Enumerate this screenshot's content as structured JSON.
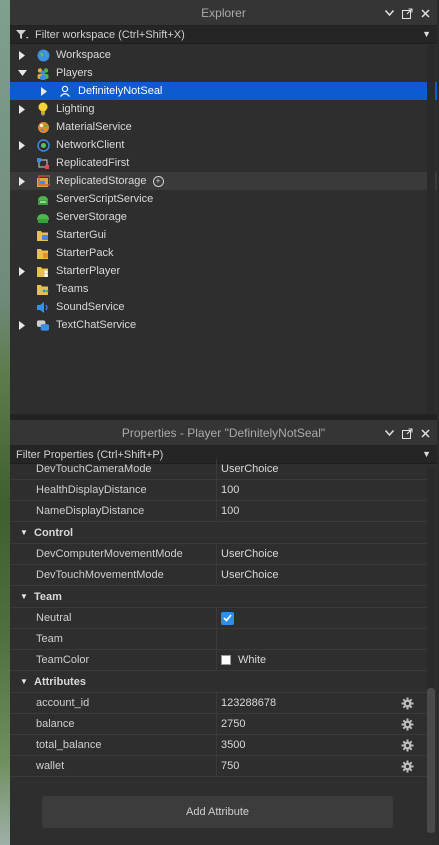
{
  "explorer": {
    "title": "Explorer",
    "filter_placeholder": "Filter workspace (Ctrl+Shift+X)",
    "items": [
      {
        "label": "Workspace",
        "icon": "globe-icon",
        "arrow": "right"
      },
      {
        "label": "Players",
        "icon": "players-icon",
        "arrow": "down"
      },
      {
        "label": "DefinitelyNotSeal",
        "icon": "player-icon",
        "arrow": "right",
        "selected": true
      },
      {
        "label": "Lighting",
        "icon": "lightbulb-icon",
        "arrow": "right"
      },
      {
        "label": "MaterialService",
        "icon": "material-service-icon",
        "arrow": ""
      },
      {
        "label": "NetworkClient",
        "icon": "network-icon",
        "arrow": "right"
      },
      {
        "label": "ReplicatedFirst",
        "icon": "replicated-first-icon",
        "arrow": ""
      },
      {
        "label": "ReplicatedStorage",
        "icon": "replicated-storage-icon",
        "arrow": "right",
        "hover": true
      },
      {
        "label": "ServerScriptService",
        "icon": "server-script-service-icon",
        "arrow": ""
      },
      {
        "label": "ServerStorage",
        "icon": "server-storage-icon",
        "arrow": ""
      },
      {
        "label": "StarterGui",
        "icon": "starter-gui-icon",
        "arrow": ""
      },
      {
        "label": "StarterPack",
        "icon": "starter-pack-icon",
        "arrow": ""
      },
      {
        "label": "StarterPlayer",
        "icon": "starter-player-icon",
        "arrow": "right"
      },
      {
        "label": "Teams",
        "icon": "teams-icon",
        "arrow": ""
      },
      {
        "label": "SoundService",
        "icon": "sound-icon",
        "arrow": ""
      },
      {
        "label": "TextChatService",
        "icon": "chat-icon",
        "arrow": "right"
      }
    ]
  },
  "properties": {
    "title": "Properties - Player \"DefinitelyNotSeal\"",
    "filter_placeholder": "Filter Properties (Ctrl+Shift+P)",
    "top_rows": [
      {
        "name": "DevTouchCameraMode",
        "value": "UserChoice"
      },
      {
        "name": "HealthDisplayDistance",
        "value": "100"
      },
      {
        "name": "NameDisplayDistance",
        "value": "100"
      }
    ],
    "control": {
      "title": "Control",
      "rows": [
        {
          "name": "DevComputerMovementMode",
          "value": "UserChoice"
        },
        {
          "name": "DevTouchMovementMode",
          "value": "UserChoice"
        }
      ]
    },
    "team": {
      "title": "Team",
      "neutral_label": "Neutral",
      "neutral_checked": true,
      "team_label": "Team",
      "team_value": "",
      "teamcolor_label": "TeamColor",
      "teamcolor_value": "White",
      "teamcolor_swatch": "#ffffff"
    },
    "attributes": {
      "title": "Attributes",
      "rows": [
        {
          "name": "account_id",
          "value": "123288678"
        },
        {
          "name": "balance",
          "value": "2750"
        },
        {
          "name": "total_balance",
          "value": "3500"
        },
        {
          "name": "wallet",
          "value": "750"
        }
      ],
      "add_label": "Add Attribute"
    }
  },
  "colors": {
    "selection": "#0b5ccf",
    "checkbox": "#2f8fe8"
  }
}
